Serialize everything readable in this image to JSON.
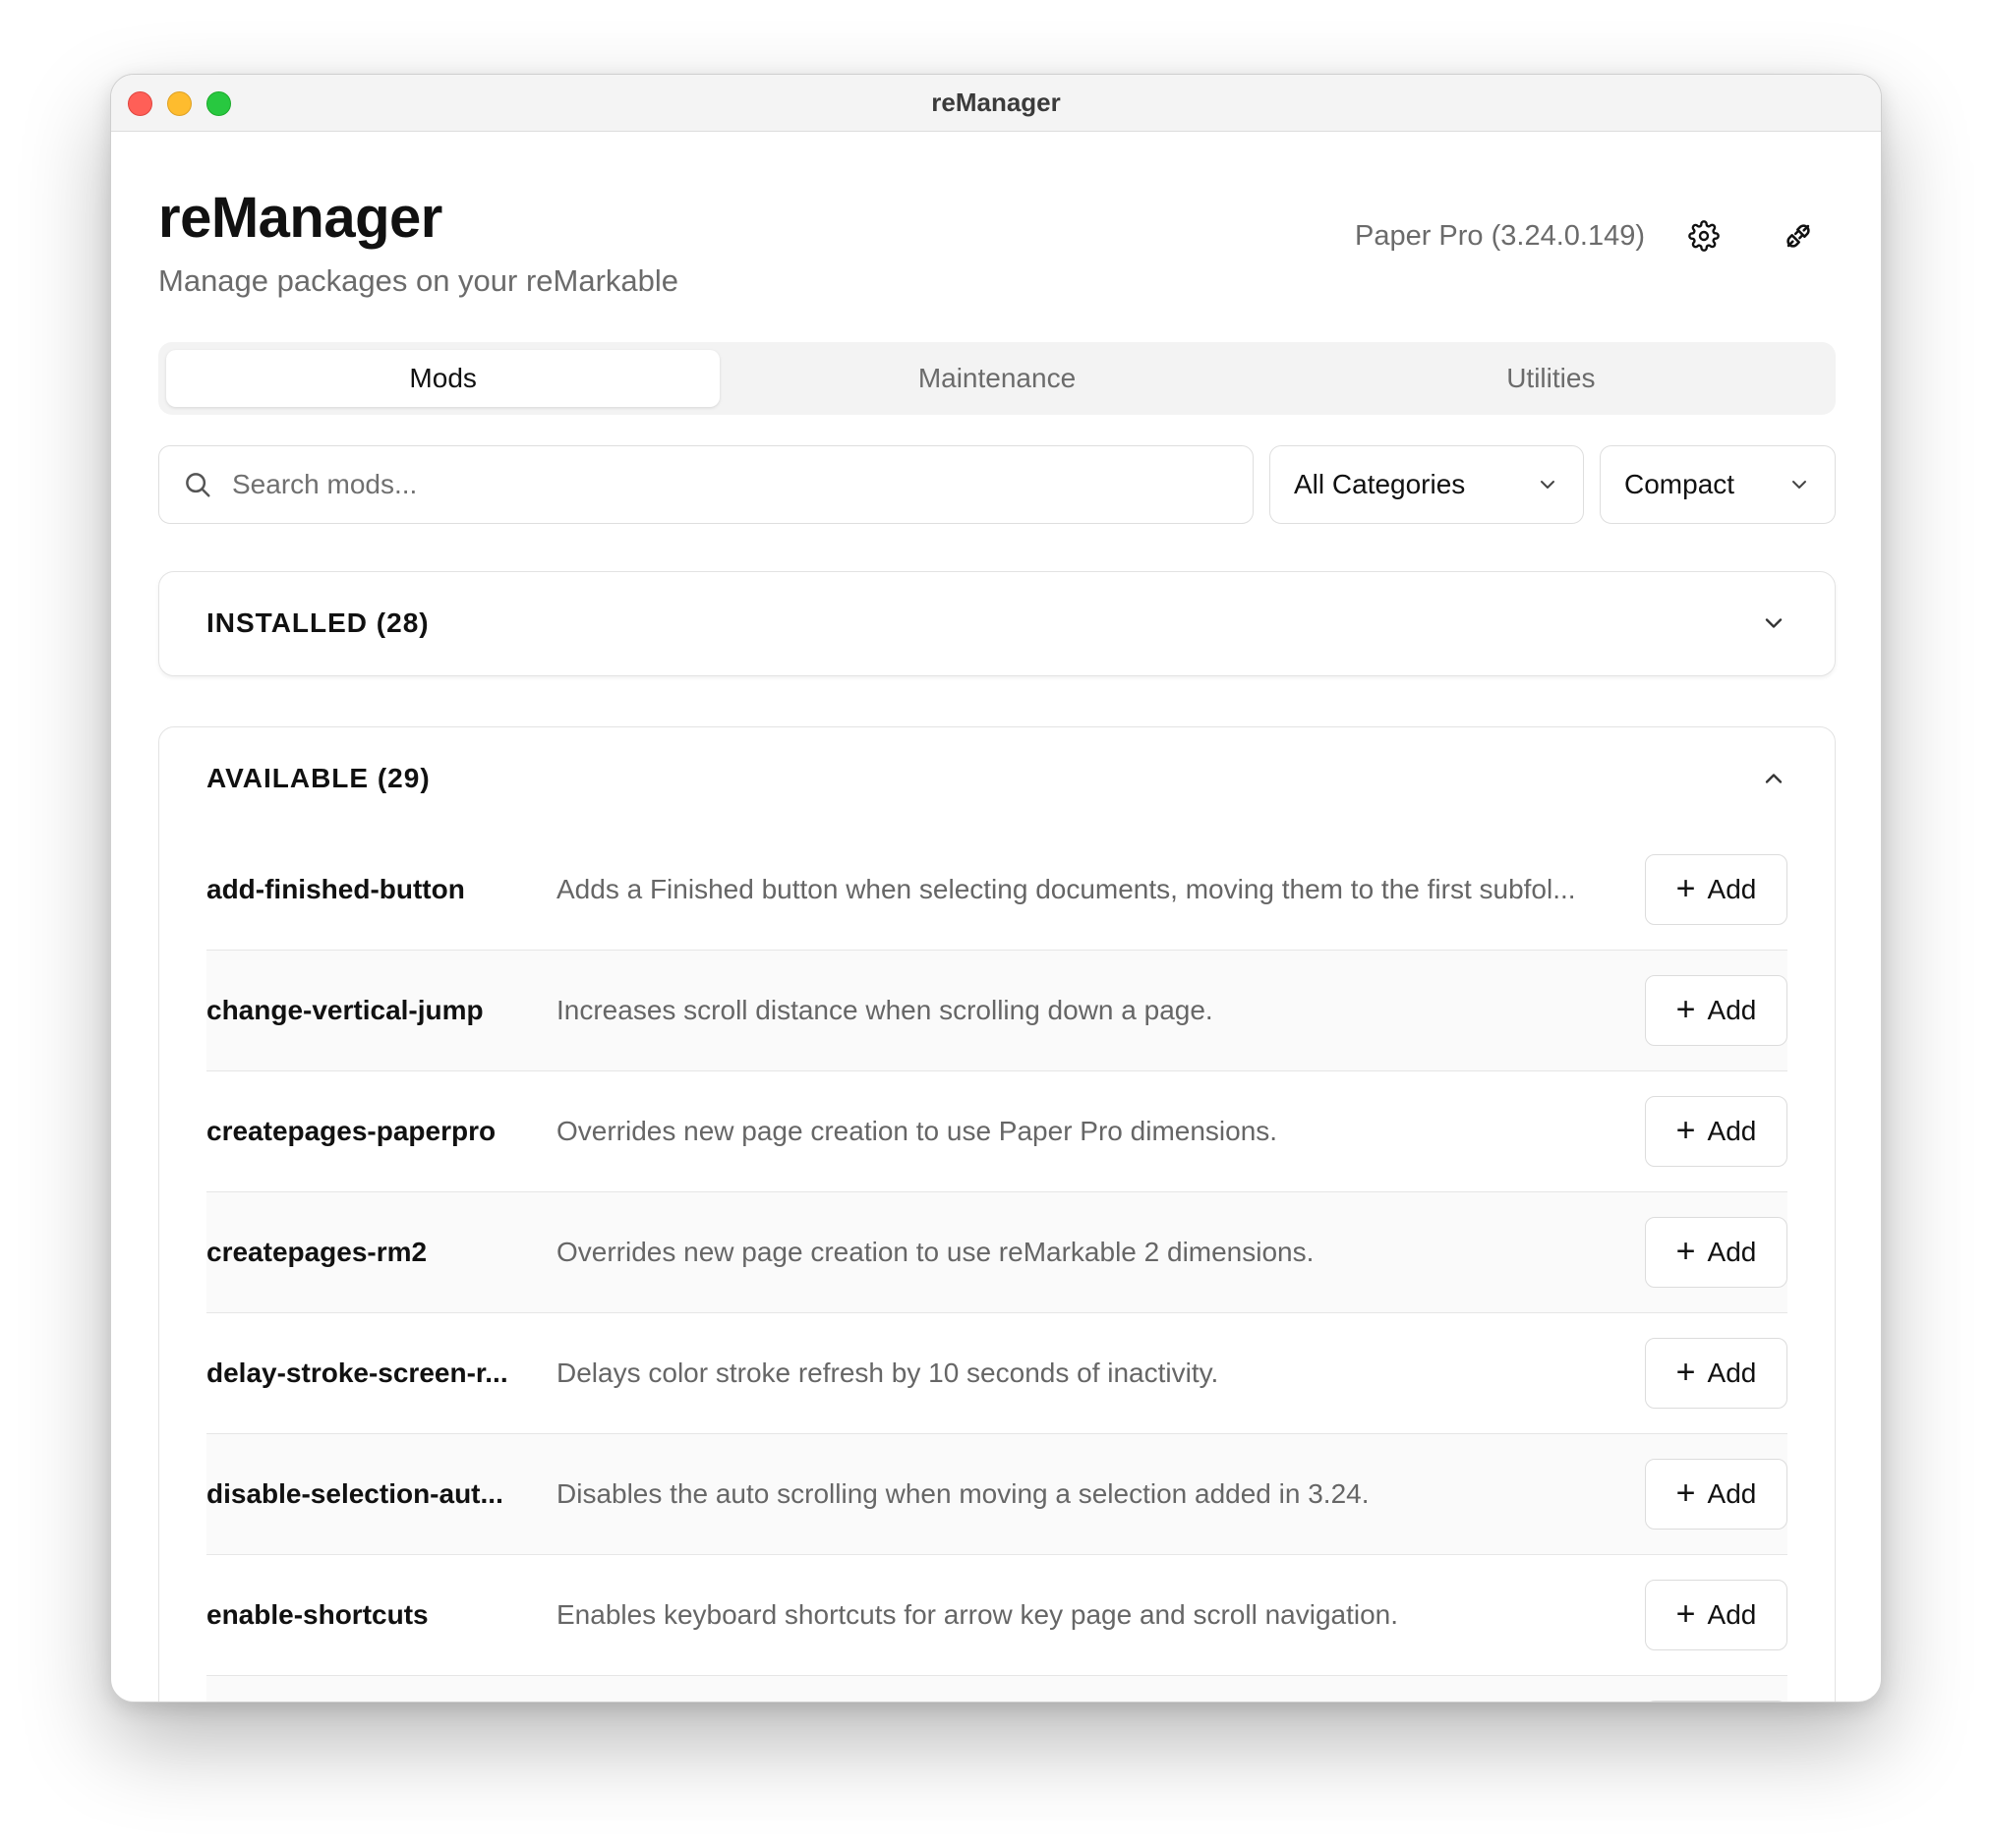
{
  "window": {
    "title": "reManager"
  },
  "header": {
    "title": "reManager",
    "subtitle": "Manage packages on your reMarkable",
    "device": "Paper Pro (3.24.0.149)"
  },
  "tabs": [
    {
      "label": "Mods",
      "active": true
    },
    {
      "label": "Maintenance",
      "active": false
    },
    {
      "label": "Utilities",
      "active": false
    }
  ],
  "search": {
    "placeholder": "Search mods...",
    "value": ""
  },
  "filters": {
    "category": "All Categories",
    "view": "Compact"
  },
  "installed": {
    "title": "INSTALLED (28)",
    "expanded": false
  },
  "available": {
    "title": "AVAILABLE (29)",
    "expanded": true,
    "add_label": "Add",
    "items": [
      {
        "name": "add-finished-button",
        "description": "Adds a Finished button when selecting documents, moving them to the first subfol..."
      },
      {
        "name": "change-vertical-jump",
        "description": "Increases scroll distance when scrolling down a page."
      },
      {
        "name": "createpages-paperpro",
        "description": "Overrides new page creation to use Paper Pro dimensions."
      },
      {
        "name": "createpages-rm2",
        "description": "Overrides new page creation to use reMarkable 2 dimensions."
      },
      {
        "name": "delay-stroke-screen-r...",
        "description": "Delays color stroke refresh by 10 seconds of inactivity."
      },
      {
        "name": "disable-selection-aut...",
        "description": "Disables the auto scrolling when moving a selection added in 3.24."
      },
      {
        "name": "enable-shortcuts",
        "description": "Enables keyboard shortcuts for arrow key page and scroll navigation."
      }
    ]
  },
  "icons": {
    "close": "close-dot",
    "minimize": "minimize-dot",
    "zoom": "zoom-dot",
    "settings": "gear-icon",
    "connection": "plug-icon",
    "search": "search-icon",
    "dropdown": "chevron-down-icon",
    "collapse": "chevron-up-icon",
    "add": "plus-icon"
  }
}
